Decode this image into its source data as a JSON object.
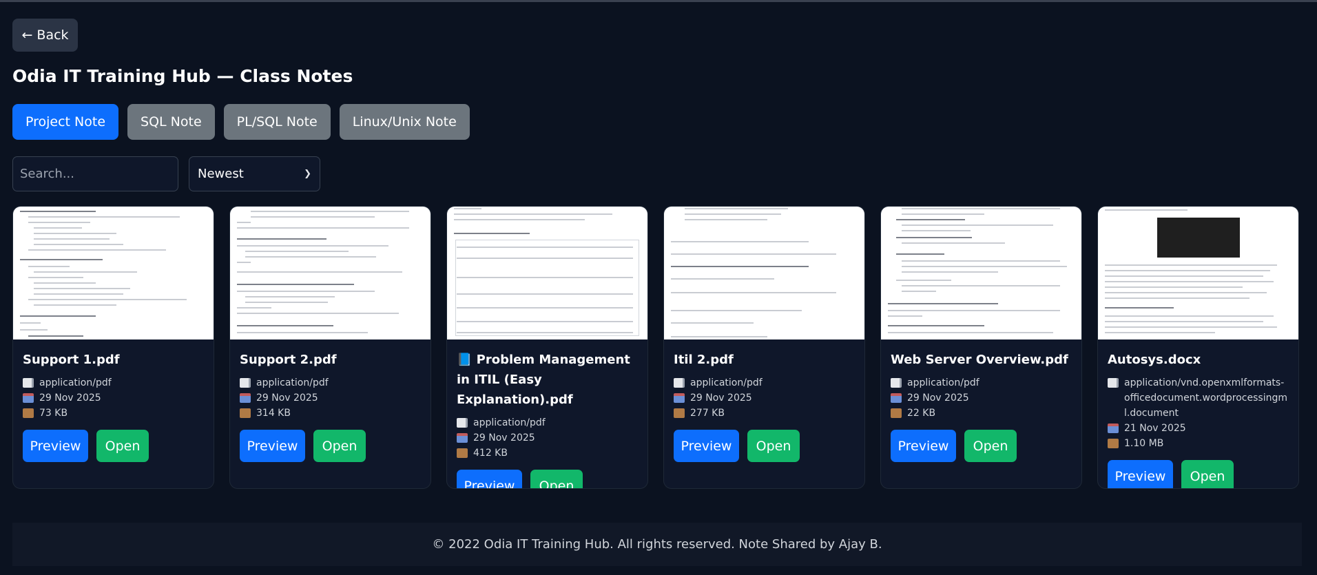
{
  "back_label": "← Back",
  "page_title": "Odia IT Training Hub — Class Notes",
  "tabs": [
    {
      "label": "Project Note",
      "active": true
    },
    {
      "label": "SQL Note",
      "active": false
    },
    {
      "label": "PL/SQL Note",
      "active": false
    },
    {
      "label": "Linux/Unix Note",
      "active": false
    }
  ],
  "search": {
    "placeholder": "Search..."
  },
  "sort": {
    "selected": "Newest"
  },
  "cards": [
    {
      "title": "Support 1.pdf",
      "type": "application/pdf",
      "date": "29 Nov 2025",
      "size": "73 KB",
      "preview_label": "Preview",
      "open_label": "Open"
    },
    {
      "title": "Support 2.pdf",
      "type": "application/pdf",
      "date": "29 Nov 2025",
      "size": "314 KB",
      "preview_label": "Preview",
      "open_label": "Open"
    },
    {
      "title": "📘 Problem Management in ITIL (Easy Explanation).pdf",
      "type": "application/pdf",
      "date": "29 Nov 2025",
      "size": "412 KB",
      "preview_label": "Preview",
      "open_label": "Open"
    },
    {
      "title": "Itil 2.pdf",
      "type": "application/pdf",
      "date": "29 Nov 2025",
      "size": "277 KB",
      "preview_label": "Preview",
      "open_label": "Open"
    },
    {
      "title": "Web Server Overview.pdf",
      "type": "application/pdf",
      "date": "29 Nov 2025",
      "size": "22 KB",
      "preview_label": "Preview",
      "open_label": "Open"
    },
    {
      "title": "Autosys.docx",
      "type": "application/vnd.openxmlformats-officedocument.wordprocessingml.document",
      "date": "21 Nov 2025",
      "size": "1.10 MB",
      "preview_label": "Preview",
      "open_label": "Open"
    }
  ],
  "footer": "© 2022 Odia IT Training Hub. All rights reserved. Note Shared by Ajay B.",
  "colors": {
    "primary": "#0d6efd",
    "success": "#12b76a",
    "secondary": "#6c757d",
    "background": "#0b1220"
  },
  "icons": {
    "type": "document-icon",
    "date": "calendar-icon",
    "size": "package-icon"
  }
}
